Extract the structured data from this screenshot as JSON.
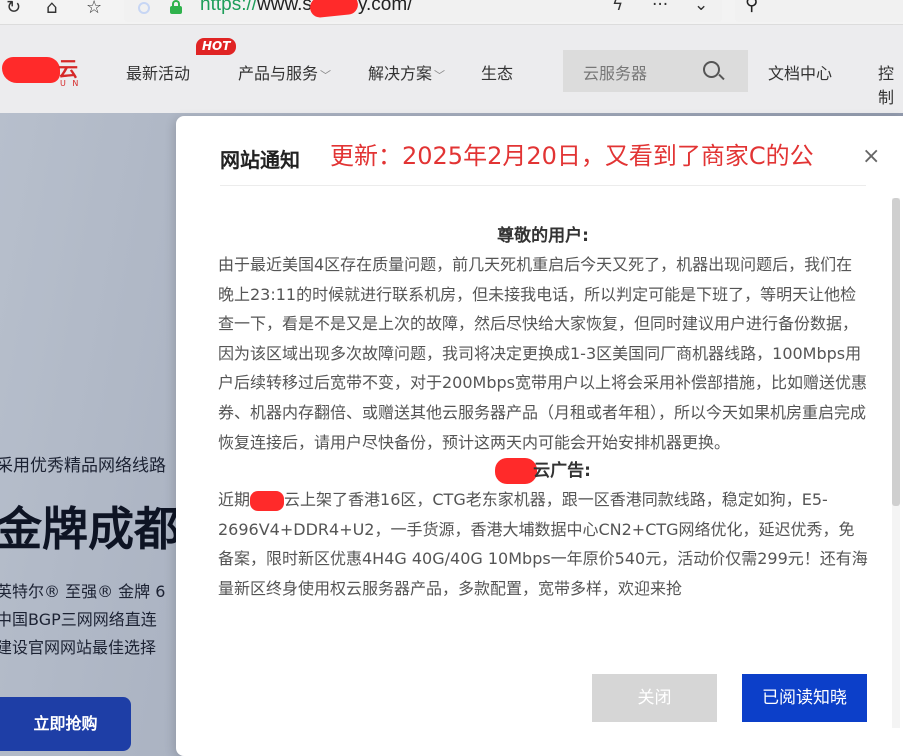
{
  "browser": {
    "url_scheme": "https://",
    "url_host_visible": "www.s",
    "url_host_tail": "y.com/",
    "nav_icons": [
      "reload-icon",
      "home-icon",
      "favorites-icon"
    ],
    "address_icons": [
      "bolt-icon",
      "more-icon",
      "chevron-down-icon"
    ],
    "search_icon": "search-icon"
  },
  "site": {
    "logo_text": "云",
    "logo_sub": "U N",
    "hot_badge": "HOT",
    "nav": [
      {
        "label": "最新活动",
        "has_chevron": false
      },
      {
        "label": "产品与服务",
        "has_chevron": true
      },
      {
        "label": "解决方案",
        "has_chevron": true
      },
      {
        "label": "生态",
        "has_chevron": false
      }
    ],
    "search_placeholder": "云服务器",
    "right_nav": [
      "文档中心",
      "控制"
    ]
  },
  "hero": {
    "subtitle": "采用优秀精品网络线路",
    "headline": "金牌成都",
    "lines": [
      "英特尔® 至强® 金牌 6",
      "中国BGP三网网络直连",
      "建设官网网站最佳选择"
    ],
    "cta": "立即抢购"
  },
  "modal": {
    "title": "网站通知",
    "marquee": "更新：2025年2月20日，又看到了商家C的公",
    "close_symbol": "×",
    "greeting": "尊敬的用户:",
    "notice_body": "由于最近美国4区存在质量问题，前几天死机重启后今天又死了，机器出现问题后，我们在晚上23:11的时候就进行联系机房，但未接我电话，所以判定可能是下班了，等明天让他检查一下，看是不是又是上次的故障，然后尽快给大家恢复，但同时建议用户进行备份数据，因为该区域出现多次故障问题，我司将决定更换成1-3区美国同厂商机器线路，100Mbps用户后续转移过后宽带不变，对于200Mbps宽带用户以上将会采用补偿部措施，比如赠送优惠券、机器内存翻倍、或赠送其他云服务器产品（月租或者年租），所以今天如果机房重启完成恢复连接后，请用户尽快备份，预计这两天内可能会开始安排机器更换。",
    "ad_heading_tail": "云广告:",
    "ad_prefix": "近期",
    "ad_body": "云上架了香港16区，CTG老东家机器，跟一区香港同款线路，稳定如狗，E5-2696V4+DDR4+U2，一手货源，香港大埔数据中心CN2+CTG网络优化，延迟优秀，免备案，限时新区优惠4H4G 40G/40G 10Mbps一年原价540元，活动价仅需299元！还有海量新区终身使用权云服务器产品，多款配置，宽带多样，欢迎来抢",
    "btn_close": "关闭",
    "btn_read": "已阅读知晓"
  },
  "colors": {
    "accent_blue": "#0c3fc9",
    "alert_red": "#e23434",
    "hot_red": "#e02424",
    "url_green": "#1e9e5a"
  }
}
